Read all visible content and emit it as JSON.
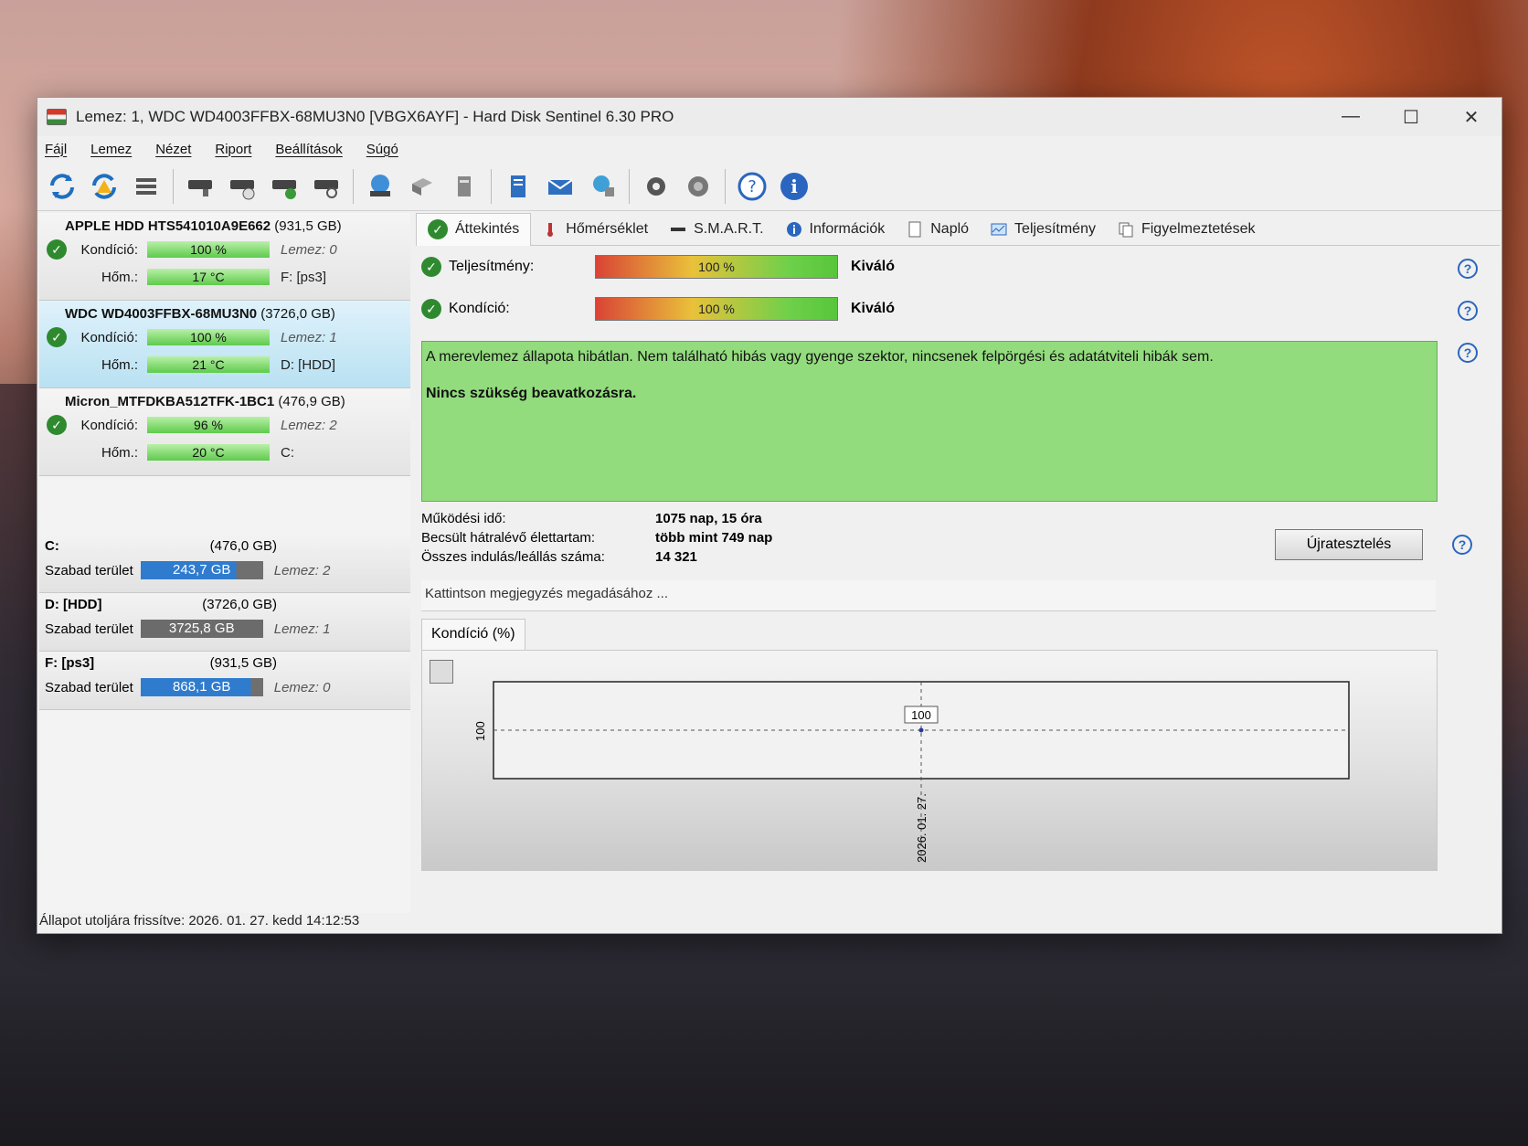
{
  "window": {
    "title": "Lemez: 1, WDC WD4003FFBX-68MU3N0 [VBGX6AYF]  -  Hard Disk Sentinel 6.30 PRO",
    "controls": [
      "—",
      "☐",
      "✕"
    ]
  },
  "menu": [
    "Fájl",
    "Lemez",
    "Nézet",
    "Riport",
    "Beállítások",
    "Súgó"
  ],
  "disks": [
    {
      "name": "APPLE HDD HTS541010A9E662",
      "capacity": "(931,5 GB)",
      "condition_label": "Kondíció:",
      "condition": "100 %",
      "temp_label": "Hőm.:",
      "temp": "17 °C",
      "disk_label": "Lemez: 0",
      "drive": "F: [ps3]"
    },
    {
      "name": "WDC WD4003FFBX-68MU3N0",
      "capacity": "(3726,0 GB)",
      "condition_label": "Kondíció:",
      "condition": "100 %",
      "temp_label": "Hőm.:",
      "temp": "21 °C",
      "disk_label": "Lemez: 1",
      "drive": "D: [HDD]"
    },
    {
      "name": "Micron_MTFDKBA512TFK-1BC1",
      "capacity": "(476,9 GB)",
      "condition_label": "Kondíció:",
      "condition": "96 %",
      "temp_label": "Hőm.:",
      "temp": "20 °C",
      "disk_label": "Lemez: 2",
      "drive": "C:"
    }
  ],
  "volumes": [
    {
      "name": "C:",
      "capacity": "(476,0 GB)",
      "free_label": "Szabad terület",
      "free": "243,7 GB",
      "disk": "Lemez: 2"
    },
    {
      "name": "D: [HDD]",
      "capacity": "(3726,0 GB)",
      "free_label": "Szabad terület",
      "free": "3725,8 GB",
      "disk": "Lemez: 1"
    },
    {
      "name": "F: [ps3]",
      "capacity": "(931,5 GB)",
      "free_label": "Szabad terület",
      "free": "868,1 GB",
      "disk": "Lemez: 0"
    }
  ],
  "tabs": [
    "Áttekintés",
    "Hőmérséklet",
    "S.M.A.R.T.",
    "Információk",
    "Napló",
    "Teljesítmény",
    "Figyelmeztetések"
  ],
  "overview": {
    "performance_label": "Teljesítmény:",
    "performance_value": "100 %",
    "performance_rating": "Kiváló",
    "condition_label": "Kondíció:",
    "condition_value": "100 %",
    "condition_rating": "Kiváló",
    "status_text": "A merevlemez állapota hibátlan. Nem található hibás vagy gyenge szektor, nincsenek felpörgési és adatátviteli hibák sem.",
    "status_bold": "Nincs szükség beavatkozásra.",
    "uptime_label": "Működési idő:",
    "uptime_value": "1075 nap, 15 óra",
    "lifetime_label": "Becsült hátralévő élettartam:",
    "lifetime_value": "több mint 749 nap",
    "startstop_label": "Összes indulás/leállás száma:",
    "startstop_value": "14 321",
    "retest_button": "Újratesztelés",
    "note_placeholder": "Kattintson megjegyzés megadásához ...",
    "chart_tab": "Kondíció  (%)"
  },
  "chart_data": {
    "type": "line",
    "x": [
      "2026. 01. 27."
    ],
    "values": [
      100
    ],
    "ytick": "100",
    "data_label": "100"
  },
  "statusbar": "Állapot utoljára frissítve: 2026. 01. 27. kedd 14:12:53",
  "colors": {
    "good": "#93dc7e",
    "accent": "#2a66c0",
    "selected": "#b9e1f2"
  }
}
